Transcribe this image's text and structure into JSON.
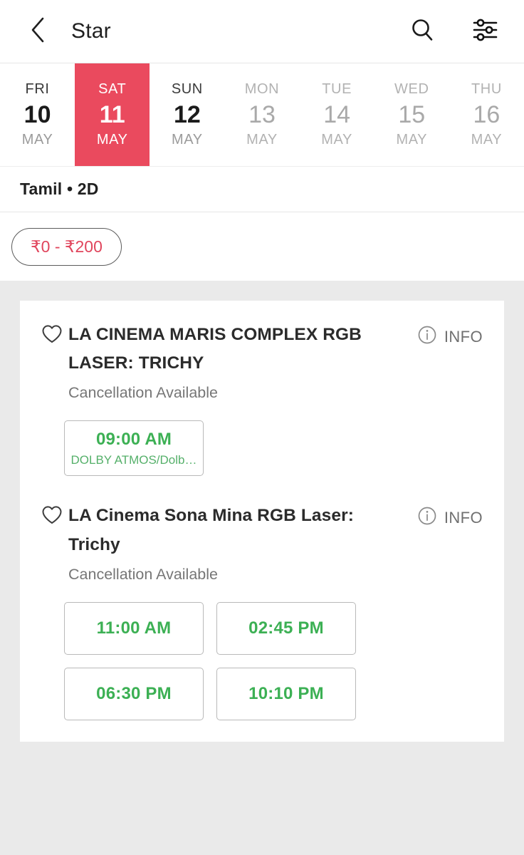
{
  "header": {
    "back_icon": "chevron-left-icon",
    "title": "Star",
    "search_icon": "search-icon",
    "filter_icon": "filter-sliders-icon"
  },
  "dates": [
    {
      "dow": "FRI",
      "day": "10",
      "month": "MAY",
      "state": "available"
    },
    {
      "dow": "SAT",
      "day": "11",
      "month": "MAY",
      "state": "selected"
    },
    {
      "dow": "SUN",
      "day": "12",
      "month": "MAY",
      "state": "available"
    },
    {
      "dow": "MON",
      "day": "13",
      "month": "MAY",
      "state": "dim"
    },
    {
      "dow": "TUE",
      "day": "14",
      "month": "MAY",
      "state": "dim"
    },
    {
      "dow": "WED",
      "day": "15",
      "month": "MAY",
      "state": "dim"
    },
    {
      "dow": "THU",
      "day": "16",
      "month": "MAY",
      "state": "dim"
    }
  ],
  "language_row": {
    "text": "Tamil  •  2D"
  },
  "filters": {
    "price_chip": "₹0 - ₹200"
  },
  "venues": [
    {
      "favourite_icon": "heart-outline-icon",
      "name": "LA CINEMA MARIS COMPLEX RGB LASER: TRICHY",
      "info_icon": "info-circle-icon",
      "info_label": "INFO",
      "cancellation": "Cancellation Available",
      "showtimes": [
        {
          "time": "09:00 AM",
          "format": "DOLBY ATMOS/Dolb…"
        }
      ]
    },
    {
      "favourite_icon": "heart-outline-icon",
      "name": "LA Cinema Sona Mina RGB Laser: Trichy",
      "info_icon": "info-circle-icon",
      "info_label": "INFO",
      "cancellation": "Cancellation Available",
      "showtimes": [
        {
          "time": "11:00 AM",
          "format": ""
        },
        {
          "time": "02:45 PM",
          "format": ""
        },
        {
          "time": "06:30 PM",
          "format": ""
        },
        {
          "time": "10:10 PM",
          "format": ""
        }
      ]
    }
  ],
  "colors": {
    "accent_red": "#ea4a5e",
    "price_red": "#e0455c",
    "showtime_green": "#3cb054",
    "page_bg": "#eaeaea"
  }
}
